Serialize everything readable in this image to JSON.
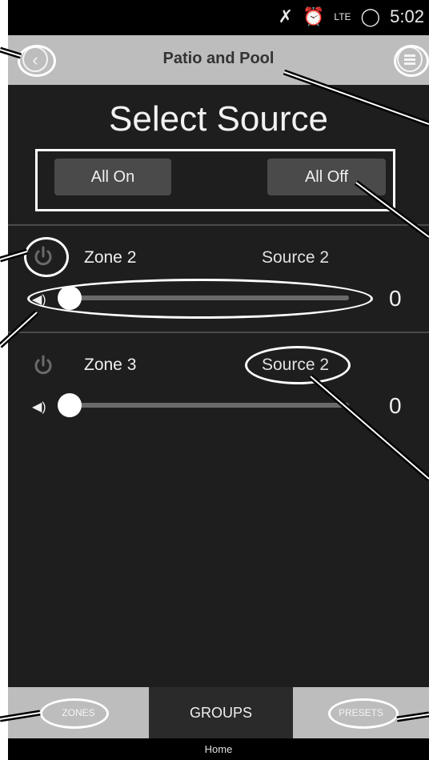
{
  "status_bar": {
    "time": "5:02",
    "lte": "LTE"
  },
  "header": {
    "title": "Patio and Pool"
  },
  "heading": "Select Source",
  "actions": {
    "all_on": "All On",
    "all_off": "All Off"
  },
  "zones": [
    {
      "name": "Zone 2",
      "source": "Source 2",
      "volume": 0,
      "volume_display": "0"
    },
    {
      "name": "Zone 3",
      "source": "Source 2",
      "volume": 0,
      "volume_display": "0"
    }
  ],
  "bottom_nav": {
    "zones": "ZONES",
    "groups": "GROUPS",
    "presets": "PRESETS",
    "active": "GROUPS"
  },
  "footer": {
    "home": "Home"
  },
  "colors": {
    "background": "#1e1e1e",
    "bar": "#bdbdbd",
    "button": "#4a4a4a",
    "active_tab": "#2a2a2a"
  }
}
